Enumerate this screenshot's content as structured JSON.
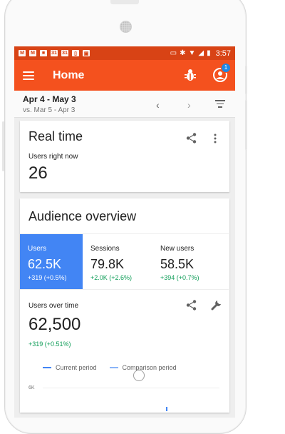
{
  "statusbar": {
    "time": "3:57"
  },
  "appbar": {
    "title": "Home",
    "notification_count": "1",
    "accent": "#f4511e",
    "status_color": "#d84315"
  },
  "datebar": {
    "range": "Apr 4 - May 3",
    "compare": "vs. Mar 5 - Apr 3",
    "prev": "‹",
    "next": "›"
  },
  "realtime": {
    "title": "Real time",
    "label": "Users right now",
    "value": "26"
  },
  "audience": {
    "title": "Audience overview",
    "tiles": [
      {
        "label": "Users",
        "value": "62.5K",
        "delta": "+319 (+0.5%)"
      },
      {
        "label": "Sessions",
        "value": "79.8K",
        "delta": "+2.0K (+2.6%)"
      },
      {
        "label": "New users",
        "value": "58.5K",
        "delta": "+394 (+0.7%)"
      }
    ],
    "over_time_label": "Users over time",
    "over_time_value": "62,500",
    "over_time_delta": "+319 (+0.51%)",
    "legend_current": "Current period",
    "legend_comparison": "Comparison period",
    "axis_label": "6K",
    "colors": {
      "current": "#4285f4",
      "comparison": "#8ab4f8",
      "positive": "#0f9d58"
    }
  }
}
